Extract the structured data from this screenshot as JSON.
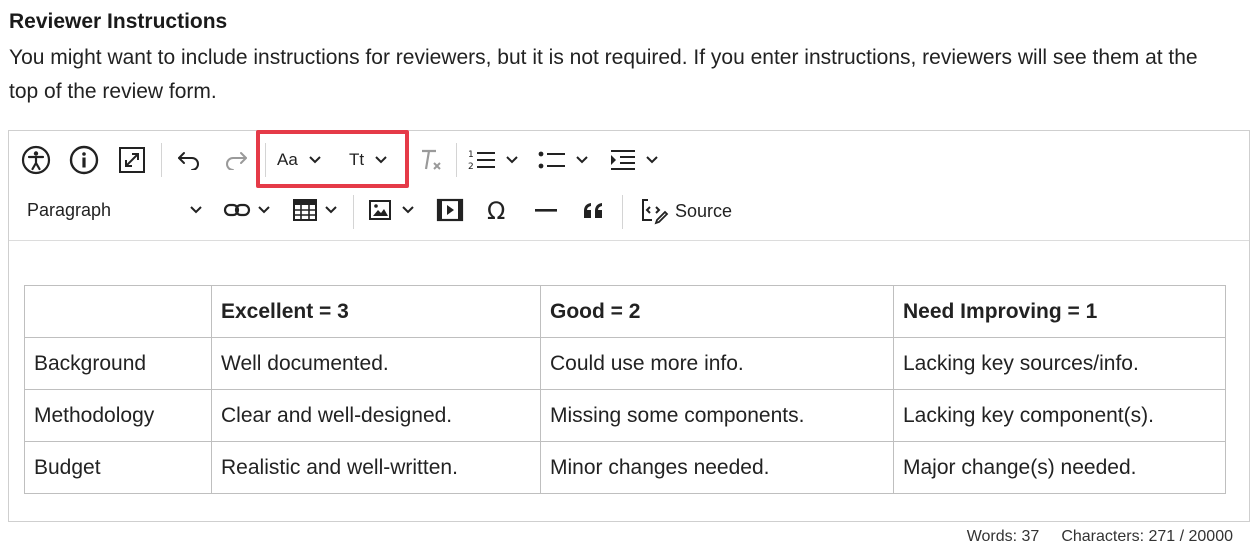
{
  "heading": "Reviewer Instructions",
  "description": "You might want to include instructions for reviewers, but it is not required. If you enter instructions, reviewers will see them at the top of the review form.",
  "toolbar": {
    "font_family_label": "Aa",
    "font_size_label": "Tt",
    "heading_select": "Paragraph",
    "source_label": "Source"
  },
  "icons": {
    "row1": [
      "accessibility-icon",
      "info-icon",
      "fullscreen-icon",
      "undo-icon",
      "redo-icon",
      "font-family-icon",
      "font-size-icon",
      "remove-format-icon",
      "numbered-list-icon",
      "bulleted-list-icon",
      "indent-icon"
    ],
    "row2": [
      "link-icon",
      "table-icon",
      "image-icon",
      "media-icon",
      "special-characters-icon",
      "horizontal-line-icon",
      "block-quote-icon",
      "source-icon"
    ]
  },
  "table": {
    "headers": [
      "",
      "Excellent = 3",
      "Good = 2",
      "Need Improving = 1"
    ],
    "rows": [
      [
        "Background",
        "Well documented.",
        "Could use more info.",
        "Lacking key sources/info."
      ],
      [
        "Methodology",
        "Clear and well-designed.",
        "Missing some components.",
        "Lacking key component(s)."
      ],
      [
        "Budget",
        "Realistic and well-written.",
        "Minor changes needed.",
        "Major change(s) needed."
      ]
    ]
  },
  "footer": {
    "words": "Words: 37",
    "characters": "Characters: 271 / 20000"
  },
  "colors": {
    "highlight": "#e53a48",
    "border": "#cfcfcf",
    "text": "#222222"
  }
}
